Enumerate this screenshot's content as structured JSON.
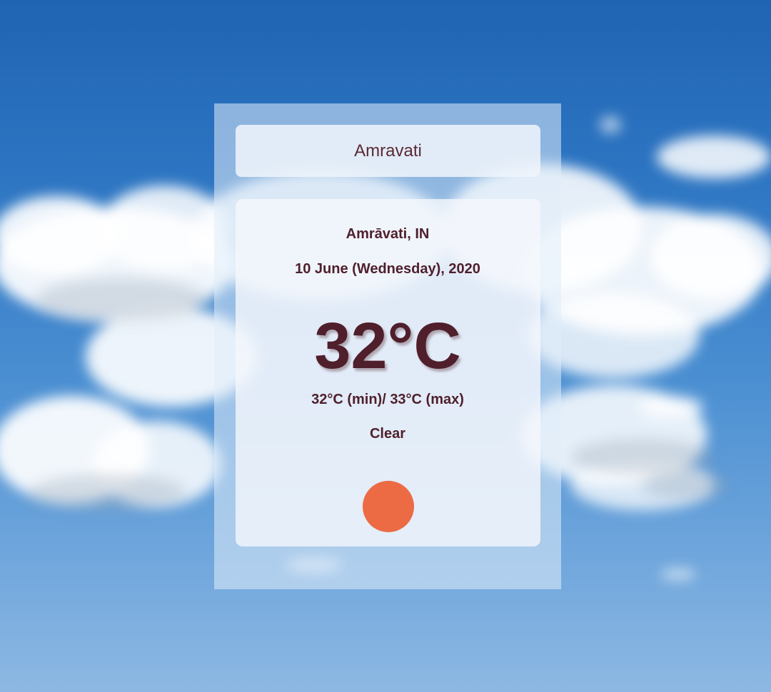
{
  "search": {
    "value": "Amravati"
  },
  "weather": {
    "location": "Amrāvati, IN",
    "date": "10 June (Wednesday), 2020",
    "temperature": "32°C",
    "min_max": "32°C (min)/ 33°C (max)",
    "condition": "Clear",
    "icon": "sun-icon"
  },
  "colors": {
    "text": "#4f1f2c",
    "sun": "#ec6b44",
    "sky_top": "#1f64b3",
    "sky_bottom": "#8db8e3"
  }
}
